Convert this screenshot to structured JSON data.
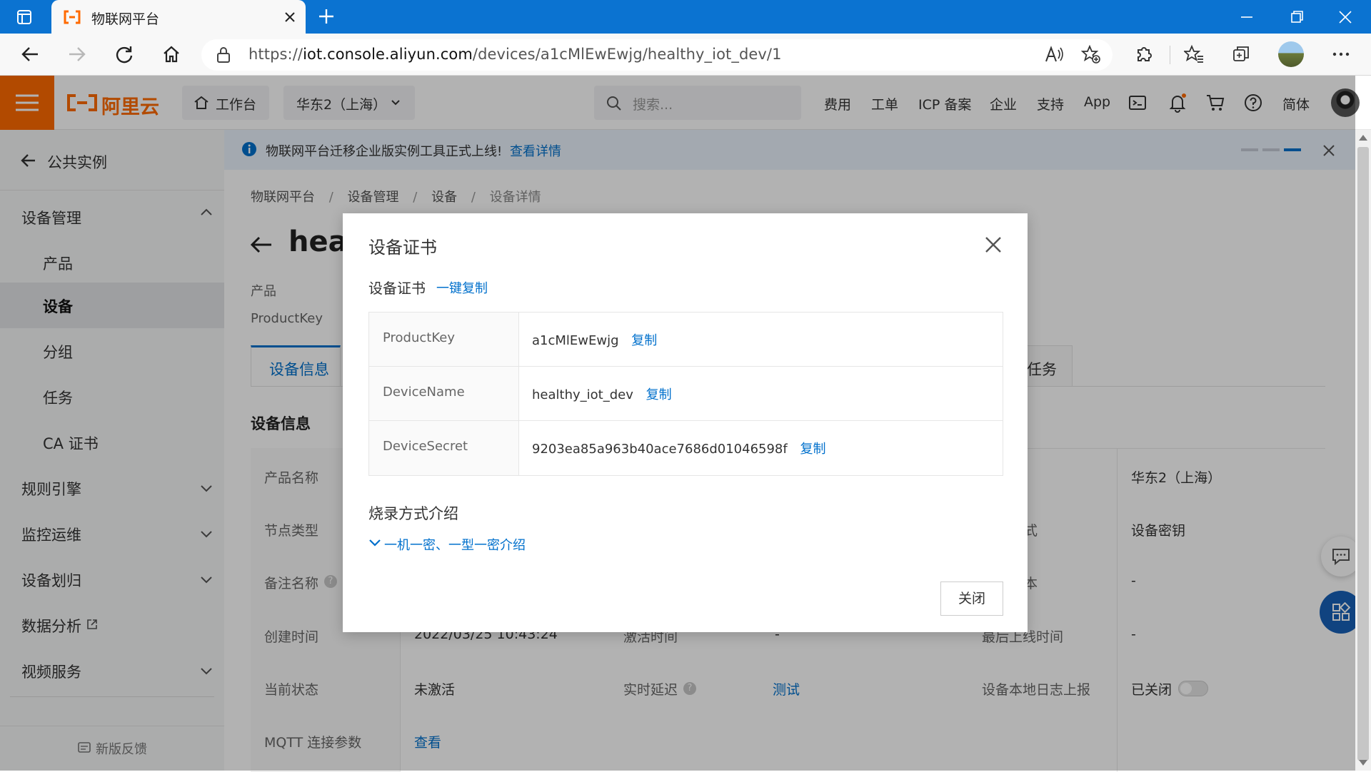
{
  "browser": {
    "tab_title": "物联网平台",
    "url_scheme": "https://",
    "url_host": "iot.console.aliyun.com",
    "url_path": "/devices/a1cMlEwEwjg/healthy_iot_dev/1"
  },
  "topnav": {
    "logo_text": "阿里云",
    "workbench": "工作台",
    "region": "华东2（上海）",
    "search_placeholder": "搜索...",
    "links": [
      "费用",
      "工单",
      "ICP 备案",
      "企业",
      "支持",
      "App"
    ],
    "language": "简体"
  },
  "sidebar": {
    "back_label": "公共实例",
    "group_device_mgmt": "设备管理",
    "items": [
      "产品",
      "设备",
      "分组",
      "任务",
      "CA 证书"
    ],
    "sections": [
      "规则引擎",
      "监控运维",
      "设备划归",
      "数据分析",
      "视频服务"
    ],
    "feedback": "新版反馈"
  },
  "banner": {
    "text": "物联网平台迁移企业版实例工具正式上线!",
    "link": "查看详情"
  },
  "breadcrumb": [
    "物联网平台",
    "设备管理",
    "设备",
    "设备详情"
  ],
  "page": {
    "title_partial": "heal",
    "meta_labels": [
      "产品",
      "ProductKey"
    ],
    "tab_active": "设备信息",
    "tab_right": "任务",
    "section_title": "设备信息"
  },
  "info_grid": {
    "labels_col1": [
      "产品名称",
      "节点类型",
      "备注名称",
      "创建时间",
      "当前状态",
      "MQTT 连接参数"
    ],
    "created_time": "2022/03/25 10:43:24",
    "activated_label": "激活时间",
    "activated_value": "-",
    "last_online_label": "最后上线时间",
    "last_online_value": "-",
    "status_value": "未激活",
    "latency_label": "实时延迟",
    "latency_link": "测试",
    "local_log_label": "设备本地日志上报",
    "local_log_value": "已关闭",
    "mqtt_link": "查看",
    "region_value": "华东2（上海）",
    "auth_fragment": "式",
    "auth_value": "设备密钥",
    "fragment_row3": "本",
    "dash_row3": "-"
  },
  "modal": {
    "title": "设备证书",
    "subtitle": "设备证书",
    "copy_all": "一键复制",
    "rows": [
      {
        "label": "ProductKey",
        "value": "a1cMlEwEwjg",
        "action": "复制"
      },
      {
        "label": "DeviceName",
        "value": "healthy_iot_dev",
        "action": "复制"
      },
      {
        "label": "DeviceSecret",
        "value": "9203ea85a963b40ace7686d01046598f",
        "action": "复制"
      }
    ],
    "burn_title": "烧录方式介绍",
    "burn_link": "一机一密、一型一密介绍",
    "close_button": "关闭"
  },
  "colors": {
    "browser_blue": "#0b73d1",
    "aliyun_orange": "#ff6a00",
    "link_blue": "#0070cc",
    "float_button_blue": "#1861b8"
  }
}
